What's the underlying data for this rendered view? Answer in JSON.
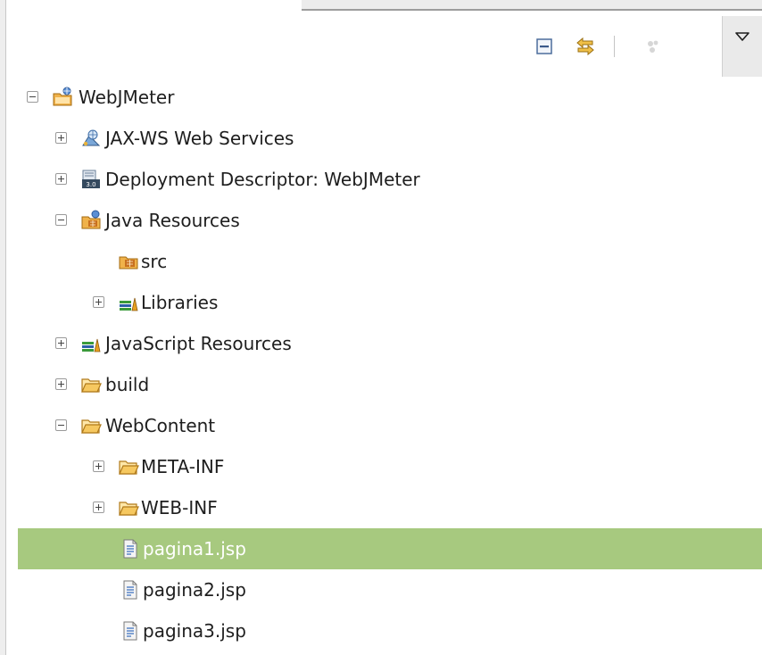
{
  "toolbar": {
    "collapse_all": "collapse-all-icon",
    "link_with_editor": "link-with-editor-icon",
    "filter": "filter-icon",
    "view_menu": "view-menu-icon"
  },
  "tree": {
    "items": [
      {
        "label": "WebJMeter",
        "icon": "dynamic-web-project-icon",
        "expander": "minus"
      },
      {
        "label": "JAX-WS Web Services",
        "icon": "web-services-icon",
        "expander": "plus"
      },
      {
        "label": "Deployment Descriptor: WebJMeter",
        "icon": "deployment-descriptor-icon",
        "expander": "plus"
      },
      {
        "label": "Java Resources",
        "icon": "java-resources-icon",
        "expander": "minus"
      },
      {
        "label": "src",
        "icon": "source-folder-icon",
        "expander": "none"
      },
      {
        "label": "Libraries",
        "icon": "libraries-icon",
        "expander": "plus"
      },
      {
        "label": "JavaScript Resources",
        "icon": "javascript-libraries-icon",
        "expander": "plus"
      },
      {
        "label": "build",
        "icon": "folder-icon",
        "expander": "plus"
      },
      {
        "label": "WebContent",
        "icon": "folder-icon",
        "expander": "minus"
      },
      {
        "label": "META-INF",
        "icon": "folder-icon",
        "expander": "plus"
      },
      {
        "label": "WEB-INF",
        "icon": "folder-icon",
        "expander": "plus"
      },
      {
        "label": "pagina1.jsp",
        "icon": "jsp-file-icon",
        "expander": "none",
        "selected": true
      },
      {
        "label": "pagina2.jsp",
        "icon": "jsp-file-icon",
        "expander": "none"
      },
      {
        "label": "pagina3.jsp",
        "icon": "jsp-file-icon",
        "expander": "none"
      }
    ]
  },
  "colors": {
    "selection": "#a7c97f",
    "selected_text": "#ffffff",
    "folder": "#e8a33c"
  }
}
